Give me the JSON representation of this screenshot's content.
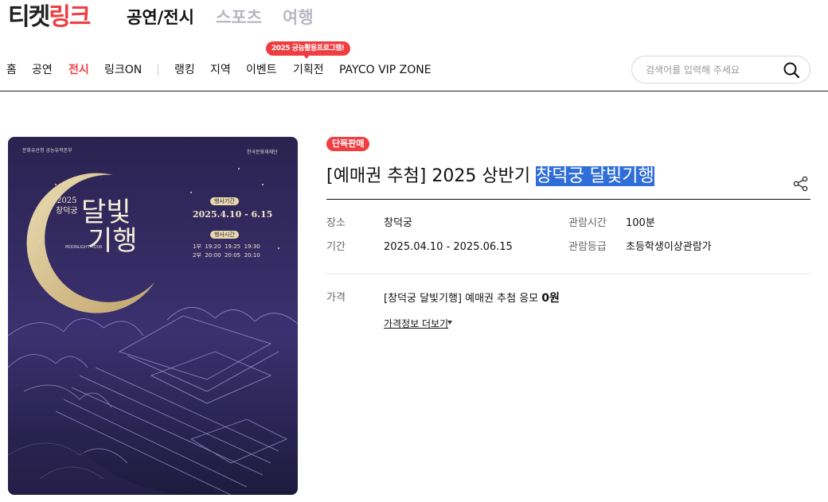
{
  "logo": {
    "part1": "티켓",
    "part2": "링크"
  },
  "categories": [
    {
      "label": "공연/전시",
      "active": true
    },
    {
      "label": "스포츠",
      "active": false
    },
    {
      "label": "여행",
      "active": false
    }
  ],
  "nav": {
    "items": [
      "홈",
      "공연",
      "전시",
      "링크ON",
      "랭킹",
      "지역",
      "이벤트",
      "기획전",
      "PAYCO VIP ZONE"
    ],
    "active": "전시",
    "promo_tag": "2025 궁능활용프로그램!"
  },
  "search": {
    "placeholder": "검색어를 입력해 주세요"
  },
  "poster": {
    "top_left": "문화유산청 궁능유적본부",
    "top_right": "한국문화재재단",
    "year_place": "2025\n창덕궁",
    "main_title_1": "달빛",
    "main_title_2": "기행",
    "period_label": "행사기간",
    "period": "2025.4.10 - 6.15",
    "time_label": "행사시간",
    "time_1": "1부  19:20  19:25  19:30",
    "time_2": "2부  20:00  20:05  20:10",
    "english": "MOONLIGHT TOUR"
  },
  "product": {
    "badge": "단독판매",
    "title_prefix": "[예매권 추첨] 2025 상반기 ",
    "title_highlight": "창덕궁 달빛기행",
    "info": {
      "venue_label": "장소",
      "venue": "창덕궁",
      "runtime_label": "관람시간",
      "runtime": "100분",
      "period_label": "기간",
      "period": "2025.04.10 - 2025.06.15",
      "rating_label": "관람등급",
      "rating": "초등학생이상관람가"
    },
    "price_label": "가격",
    "price_text": "[창덕궁 달빛기행] 예매권 추첨 응모 ",
    "price_value": "0원",
    "more_link": "가격정보 더보기"
  },
  "colors": {
    "brand": "#ef3e42",
    "highlight": "#2f6ed8",
    "poster_bg": "#2b2453"
  }
}
